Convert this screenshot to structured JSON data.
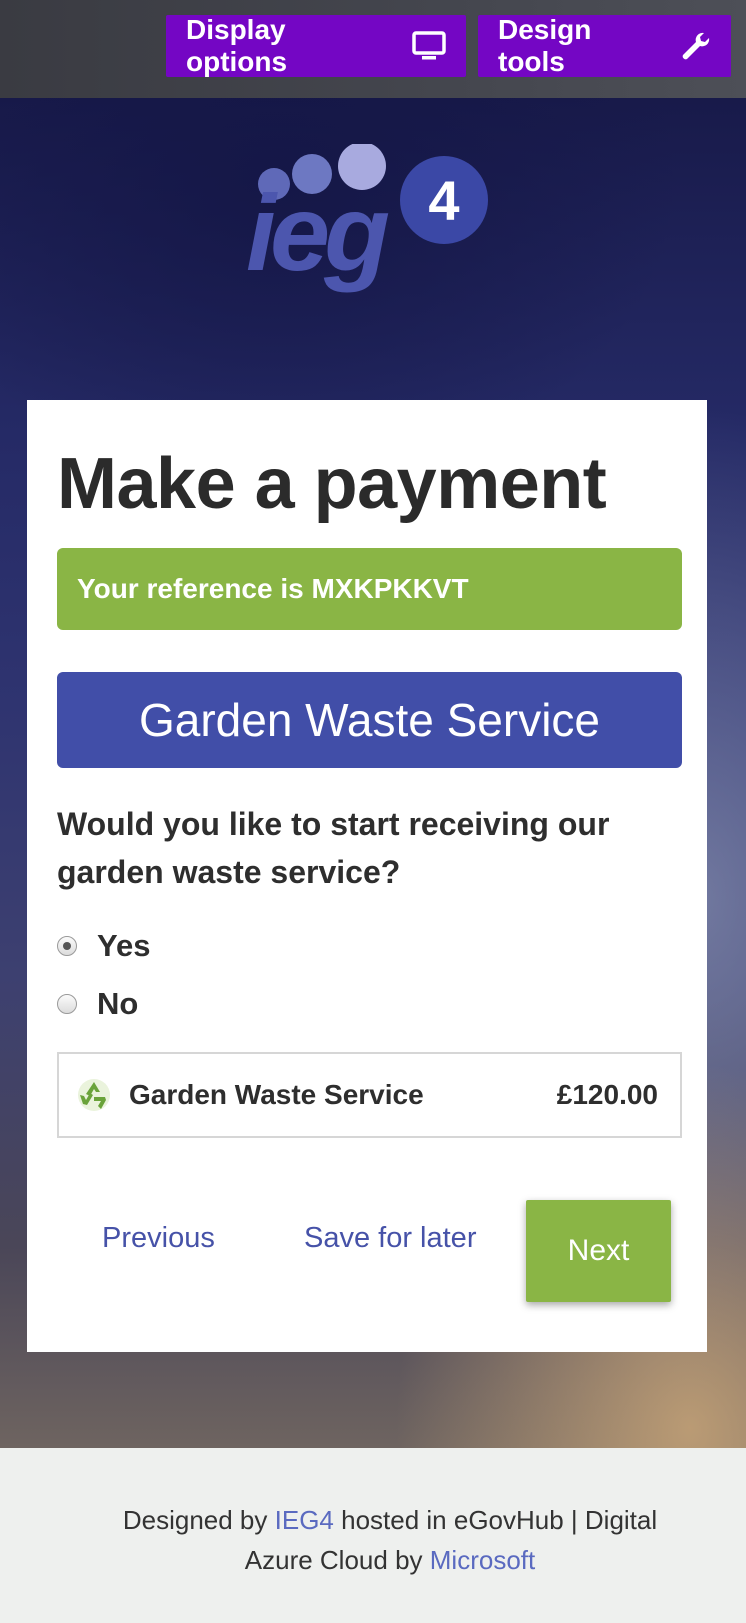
{
  "toolbar": {
    "display_options_label": "Display options",
    "design_tools_label": "Design tools",
    "button_color": "#7406c4"
  },
  "logo": {
    "text": "ieg",
    "badge": "4"
  },
  "page": {
    "title": "Make a payment",
    "reference_text": "Your reference is MXKPKKVT",
    "service_banner": "Garden Waste Service",
    "question": "Would you like to start receiving our garden waste service?",
    "options": [
      {
        "label": "Yes",
        "checked": true
      },
      {
        "label": "No",
        "checked": false
      }
    ],
    "summary": {
      "icon": "recycle-icon",
      "name": "Garden Waste Service",
      "price": "£120.00"
    },
    "nav": {
      "previous": "Previous",
      "save_for_later": "Save for later",
      "next": "Next"
    }
  },
  "footer": {
    "prefix": "Designed by",
    "ieg4_link": "IEG4",
    "middle": "hosted in eGovHub | Digital Azure Cloud by",
    "microsoft_link": "Microsoft"
  },
  "colors": {
    "accent_green": "#8ab545",
    "banner_blue": "#414ea8",
    "link_blue": "#4652a8"
  }
}
